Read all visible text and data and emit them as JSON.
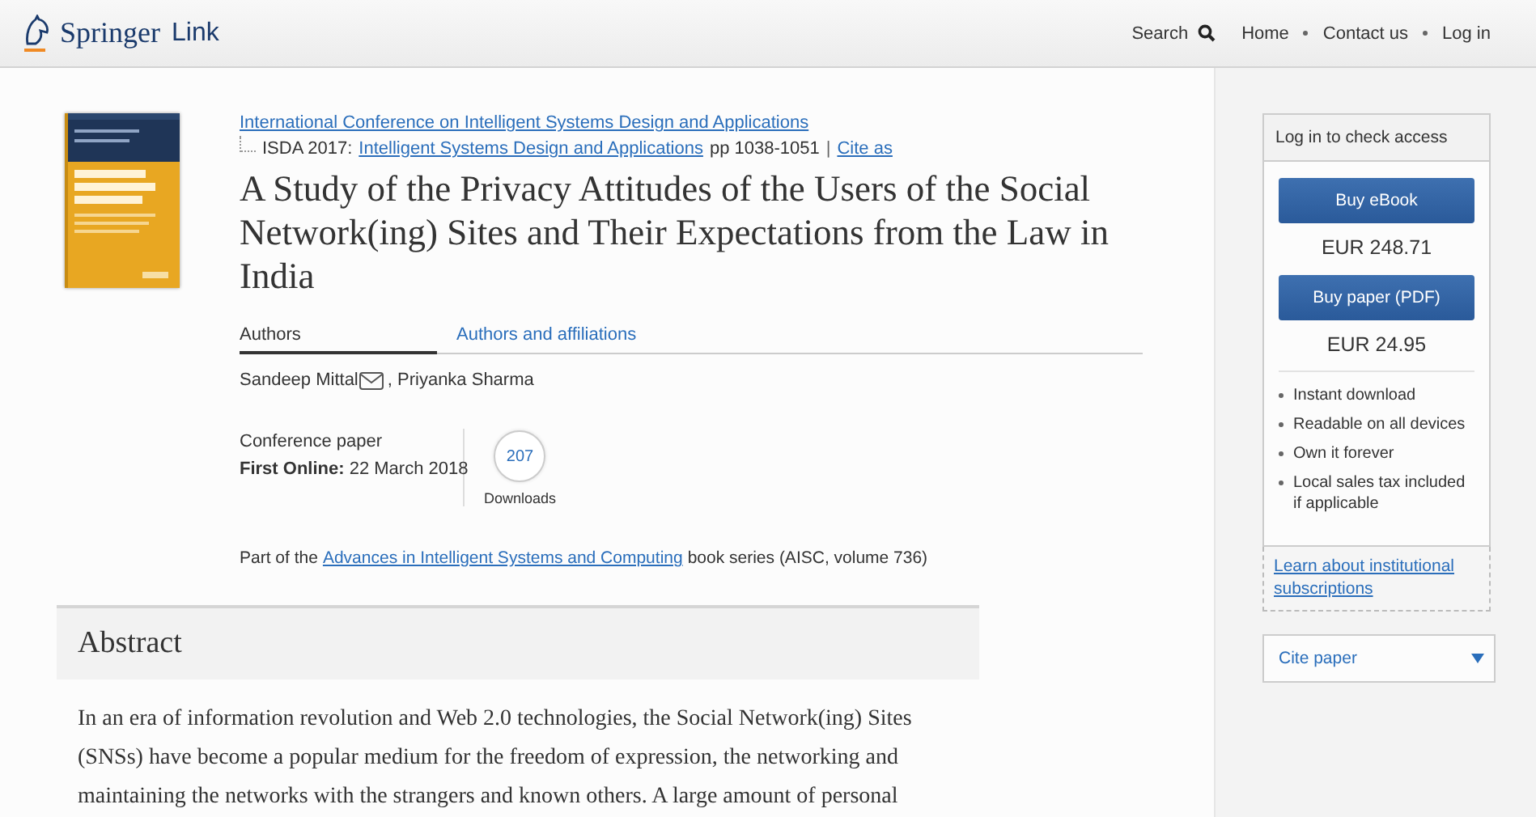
{
  "header": {
    "logo": {
      "brand": "Springer",
      "sub": "Link"
    },
    "search": "Search",
    "nav": [
      "Home",
      "Contact us",
      "Log in"
    ]
  },
  "conference": "International Conference on Intelligent Systems Design and Applications",
  "proceedings": {
    "prefix": "ISDA 2017:",
    "book": "Intelligent Systems Design and Applications",
    "pages": "pp 1038-1051",
    "separator": "|",
    "cite": "Cite as"
  },
  "title": "A Study of the Privacy Attitudes of the Users of the Social Network(ing) Sites and Their Expectations from the Law in India",
  "tabs": [
    {
      "label": "Authors",
      "selected": true
    },
    {
      "label": "Authors and affiliations",
      "selected": false
    }
  ],
  "authors": [
    {
      "name": "Sandeep Mittal",
      "email": true
    },
    {
      "name": ", Priyanka Sharma",
      "email": false
    }
  ],
  "paper_type": "Conference paper",
  "first_online": "**First Online:** 22 March 2018",
  "downloads": {
    "count": "207",
    "label": "Downloads"
  },
  "series": {
    "before": "Part of the",
    "link": "Advances in Intelligent Systems and Computing",
    "after": "book series (AISC, volume 736)"
  },
  "abstract": {
    "heading": "Abstract",
    "lines": [
      "In an era of information revolution and Web 2.0 technologies, the Social Network(ing) Sites",
      "(SNSs) have become a popular medium for the freedom of expression, the networking and",
      "maintaining the networks with the strangers and known others. A large amount of personal"
    ]
  },
  "sidebar": {
    "access_heading": "Log in to check access",
    "offers": [
      {
        "button": "Buy eBook",
        "price": "EUR 248.71"
      },
      {
        "button": "Buy paper (PDF)",
        "price": "EUR 24.95"
      }
    ],
    "benefits": [
      "Instant download",
      "Readable on all devices",
      "Own it forever",
      "Local sales tax included if applicable"
    ],
    "institutional_link": "Learn about institutional subscriptions",
    "cite_dropdown": {
      "label": "Cite paper",
      "expanded": false
    }
  }
}
